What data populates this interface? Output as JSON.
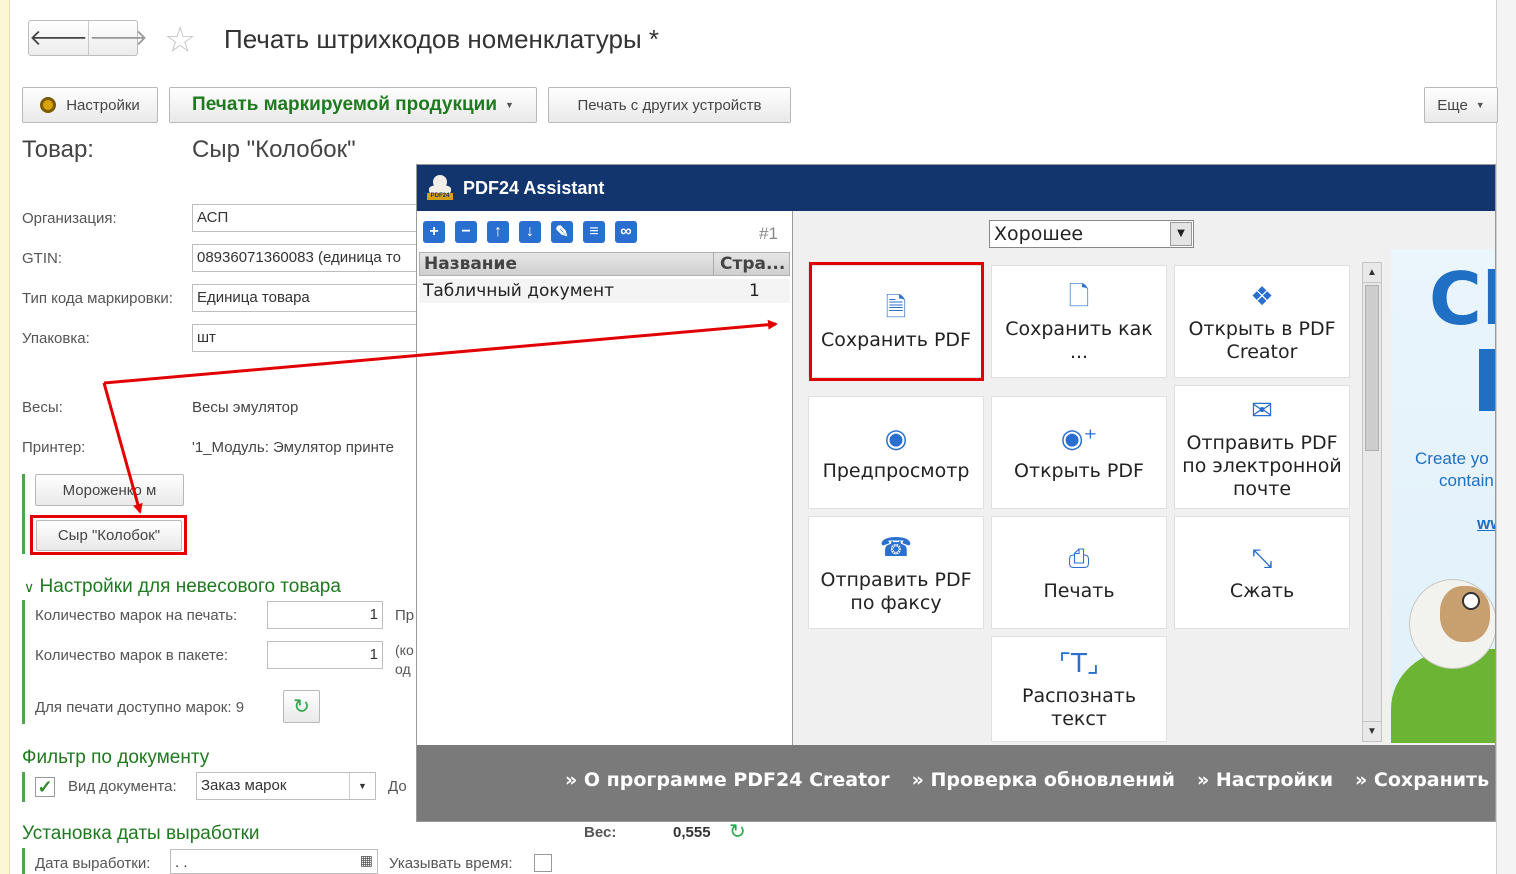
{
  "header": {
    "back_icon": "arrow-left-icon",
    "forward_icon": "arrow-right-icon",
    "title": "Печать штрихкодов номенклатуры *"
  },
  "toolbar": {
    "settings": "Настройки",
    "print_marked": "Печать маркируемой продукции",
    "print_other": "Печать с других устройств",
    "more": "Еще"
  },
  "product": {
    "label": "Товар:",
    "value": "Сыр \"Колобок\""
  },
  "form": {
    "org_label": "Организация:",
    "org_value": "АСП",
    "gtin_label": "GTIN:",
    "gtin_value": "08936071360083 (единица то",
    "marktype_label": "Тип кода маркировки:",
    "marktype_value": "Единица товара",
    "pack_label": "Упаковка:",
    "pack_value": "шт",
    "scales_label": "Весы:",
    "scales_value": "Весы эмулятор",
    "printer_label": "Принтер:",
    "printer_value": "'1_Модуль: Эмулятор принте"
  },
  "product_buttons": [
    "Мороженко м",
    "Сыр \"Колобок\""
  ],
  "nonweight": {
    "heading": "Настройки для невесового товара",
    "count_print_label": "Количество марок на печать:",
    "count_print_value": "1",
    "count_print_suffix": "Пр",
    "count_pack_label": "Количество марок в пакете:",
    "count_pack_value": "1",
    "count_pack_suffix1": "(ко",
    "count_pack_suffix2": "од",
    "available": "Для печати доступно марок: 9"
  },
  "filter": {
    "heading": "Фильтр по документу",
    "doc_type_label": "Вид документа:",
    "doc_type_value": "Заказ марок",
    "doc_suffix": "До"
  },
  "production_date": {
    "heading": "Установка даты выработки",
    "date_label": "Дата выработки:",
    "date_value": " .  .",
    "time_label": "Указывать время:"
  },
  "weight": {
    "label": "Вес:",
    "value": "0,555"
  },
  "pdf24": {
    "title": "PDF24 Assistant",
    "page_counter": "#1",
    "quality": "Хорошее",
    "table": {
      "col_name": "Название",
      "col_pages": "Стра...",
      "rows": [
        {
          "name": "Табличный документ",
          "pages": "1"
        }
      ]
    },
    "tiles": [
      {
        "label": "Сохранить PDF",
        "icon": "save-pdf-icon"
      },
      {
        "label": "Сохранить как ...",
        "icon": "save-as-icon"
      },
      {
        "label": "Открыть в PDF Creator",
        "icon": "cubes-icon"
      },
      {
        "label": "Предпросмотр",
        "icon": "eye-icon"
      },
      {
        "label": "Открыть PDF",
        "icon": "eye-plus-icon"
      },
      {
        "label": "Отправить PDF по электронной почте",
        "icon": "envelope-icon"
      },
      {
        "label": "Отправить PDF по факсу",
        "icon": "fax-icon"
      },
      {
        "label": "Печать",
        "icon": "printer-icon"
      },
      {
        "label": "Сжать",
        "icon": "compress-icon"
      },
      {
        "label": "Распознать текст",
        "icon": "ocr-icon"
      }
    ],
    "ad_title": "Cl",
    "ad_text1": "Create yo",
    "ad_text2": "contain",
    "ad_text3": "ww",
    "bottom_links": [
      "» О программе PDF24 Creator",
      "» Проверка обновлений",
      "» Настройки",
      "» Сохранить про"
    ]
  },
  "colors": {
    "accent_green": "#1f7a1f",
    "highlight_red": "#e30000",
    "pdf24_blue": "#13356e"
  }
}
